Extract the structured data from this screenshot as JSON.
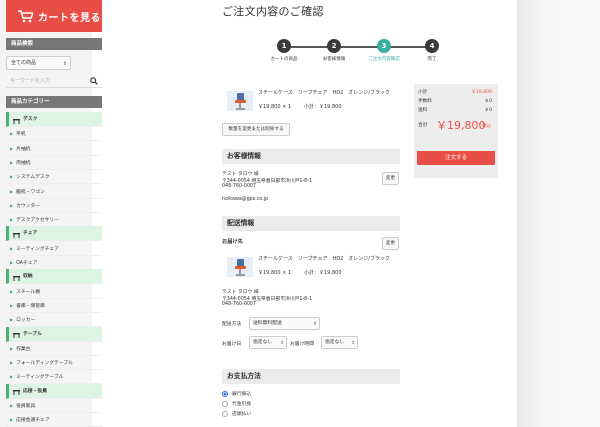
{
  "cart_button": {
    "label": "カートを見る"
  },
  "product_search": {
    "heading": "商品検索",
    "category_select": "全ての商品",
    "keyword_placeholder": "キーワードを入力"
  },
  "categories": {
    "heading": "商品カテゴリー",
    "items": [
      {
        "label": "デスク",
        "main": true,
        "icon": "desk-icon"
      },
      {
        "label": "平机",
        "main": false
      },
      {
        "label": "片袖机",
        "main": false
      },
      {
        "label": "両袖机",
        "main": false
      },
      {
        "label": "システムデスク",
        "main": false
      },
      {
        "label": "脇机・ワゴン",
        "main": false
      },
      {
        "label": "カウンター",
        "main": false
      },
      {
        "label": "デスクアクセサリー",
        "main": false
      },
      {
        "label": "チェア",
        "main": true,
        "icon": "chair-icon"
      },
      {
        "label": "ミーティングチェア",
        "main": false
      },
      {
        "label": "OAチェア",
        "main": false
      },
      {
        "label": "収納",
        "main": true,
        "icon": "storage-icon"
      },
      {
        "label": "スチール棚",
        "main": false
      },
      {
        "label": "書庫・保管庫",
        "main": false
      },
      {
        "label": "ロッカー",
        "main": false
      },
      {
        "label": "テーブル",
        "main": true,
        "icon": "table-icon"
      },
      {
        "label": "作業台",
        "main": false
      },
      {
        "label": "フォールディングテーブル",
        "main": false
      },
      {
        "label": "ミーティングテーブル",
        "main": false
      },
      {
        "label": "応接・役員",
        "main": true,
        "icon": "reception-icon"
      },
      {
        "label": "役員家具",
        "main": false
      },
      {
        "label": "応接会議チェア",
        "main": false
      }
    ]
  },
  "page_title": "ご注文内容のご確認",
  "steps": [
    {
      "num": "1",
      "label": "カートの商品",
      "active": false
    },
    {
      "num": "2",
      "label": "お客様情報",
      "active": false
    },
    {
      "num": "3",
      "label": "ご注文内容確認",
      "active": true
    },
    {
      "num": "4",
      "label": "完了",
      "active": false
    }
  ],
  "cart_item": {
    "name": "スチールケース　リープチェア　HD2　オレンジ/ブラック",
    "price_qty": "￥19,800 × 1",
    "subtotal": "小計：￥19,800",
    "change_button": "数量を変更または削除する"
  },
  "customer": {
    "heading": "お客様情報",
    "edit_button": "変更",
    "name": "テスト タロウ 様",
    "address": "〒344-0054 埼玉県春日部市浜川戸1-8-1",
    "phone": "048-760-0007",
    "email": "hoikawa@gps.co.jp"
  },
  "delivery": {
    "heading": "配送情報",
    "dest_label": "お届け先",
    "edit_button": "変更",
    "item_name": "スチールケース　リープチェア　HD2　オレンジ/ブラック",
    "item_price_qty": "￥19,800 × 1",
    "item_subtotal": "小計：￥19,800",
    "name": "テスト タロウ 様",
    "address": "〒344-0054 埼玉県春日部市浜川戸1-8-1",
    "phone": "048-760-0007",
    "method_label": "配送方法",
    "method_value": "送料無料配送",
    "date_label": "お届け日",
    "date_value": "指定なし",
    "time_label": "お届け時間",
    "time_value": "指定なし"
  },
  "payment": {
    "heading": "お支払方法",
    "options": [
      {
        "label": "銀行振込",
        "selected": true
      },
      {
        "label": "代金引換",
        "selected": false
      },
      {
        "label": "店頭払い",
        "selected": false
      }
    ]
  },
  "summary": {
    "subtotal_label": "小計",
    "subtotal_value": "￥19,800",
    "fee_label": "手数料",
    "fee_value": "￥0",
    "shipping_label": "送料",
    "shipping_value": "￥0",
    "total_label": "合計",
    "total_value": "￥19,800",
    "tax_note": "税込",
    "order_button": "注文する"
  },
  "colors": {
    "accent": "#e94e46",
    "step_active": "#3aaea3",
    "category_bg": "#ddf4e4"
  }
}
